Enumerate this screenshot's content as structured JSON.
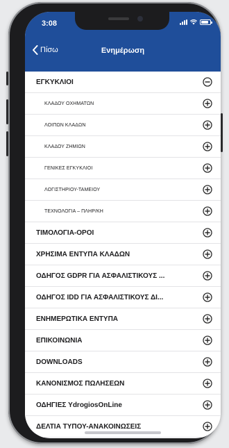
{
  "status": {
    "time": "3:08",
    "battery_level": 0.8
  },
  "nav": {
    "back_label": "Πίσω",
    "title": "Ενημέρωση"
  },
  "items": [
    {
      "label": "ΕΓΚΥΚΛΙΟΙ",
      "level": 0,
      "icon": "minus-circle-icon"
    },
    {
      "label": "ΚΛΑΔΟΥ ΟΧΗΜΑΤΩΝ",
      "level": 1,
      "icon": "plus-circle-icon"
    },
    {
      "label": "ΛΟΙΠΩΝ ΚΛΑΔΩΝ",
      "level": 1,
      "icon": "plus-circle-icon"
    },
    {
      "label": "ΚΛΑΔΟΥ ΖΗΜΙΩΝ",
      "level": 1,
      "icon": "plus-circle-icon"
    },
    {
      "label": "ΓΕΝΙΚΕΣ ΕΓΚΥΚΛΙΟΙ",
      "level": 1,
      "icon": "plus-circle-icon"
    },
    {
      "label": "ΛΟΓΙΣΤΗΡΙΟΥ-ΤΑΜΕΙΟΥ",
      "level": 1,
      "icon": "plus-circle-icon"
    },
    {
      "label": "ΤΕΧΝΟΛΟΓΙΑ – ΠΛΗΡ/ΚΗ",
      "level": 1,
      "icon": "plus-circle-icon"
    },
    {
      "label": "ΤΙΜΟΛΟΓΙΑ-ΟΡΟΙ",
      "level": 0,
      "icon": "plus-circle-icon"
    },
    {
      "label": "ΧΡΗΣΙΜΑ ΕΝΤΥΠΑ ΚΛΑΔΩΝ",
      "level": 0,
      "icon": "plus-circle-icon"
    },
    {
      "label": "ΟΔΗΓΟΣ GDPR ΓΙΑ ΑΣΦΑΛΙΣΤΙΚΟΥΣ ...",
      "level": 0,
      "icon": "plus-circle-icon"
    },
    {
      "label": "ΟΔΗΓΟΣ IDD ΓΙΑ ΑΣΦΑΛΙΣΤΙΚΟΥΣ ΔΙ...",
      "level": 0,
      "icon": "plus-circle-icon"
    },
    {
      "label": "ΕΝΗΜΕΡΩΤΙΚΑ ΕΝΤΥΠΑ",
      "level": 0,
      "icon": "plus-circle-icon"
    },
    {
      "label": "ΕΠΙΚΟΙΝΩΝΙΑ",
      "level": 0,
      "icon": "plus-circle-icon"
    },
    {
      "label": "DOWNLOADS",
      "level": 0,
      "icon": "plus-circle-icon"
    },
    {
      "label": "ΚΑΝΟΝΙΣΜΟΣ ΠΩΛΗΣΕΩΝ",
      "level": 0,
      "icon": "plus-circle-icon"
    },
    {
      "label": "ΟΔΗΓΙΕΣ YdrogiosOnLine",
      "level": 0,
      "icon": "plus-circle-icon"
    },
    {
      "label": "ΔΕΛΤΙΑ ΤΥΠΟΥ-ΑΝΑΚΟΙΝΩΣΕΙΣ",
      "level": 0,
      "icon": "plus-circle-icon"
    }
  ],
  "colors": {
    "header": "#1f4e9a",
    "text": "#1d1d1f",
    "icon": "#2b2b2b",
    "divider": "#e3e3e6"
  }
}
